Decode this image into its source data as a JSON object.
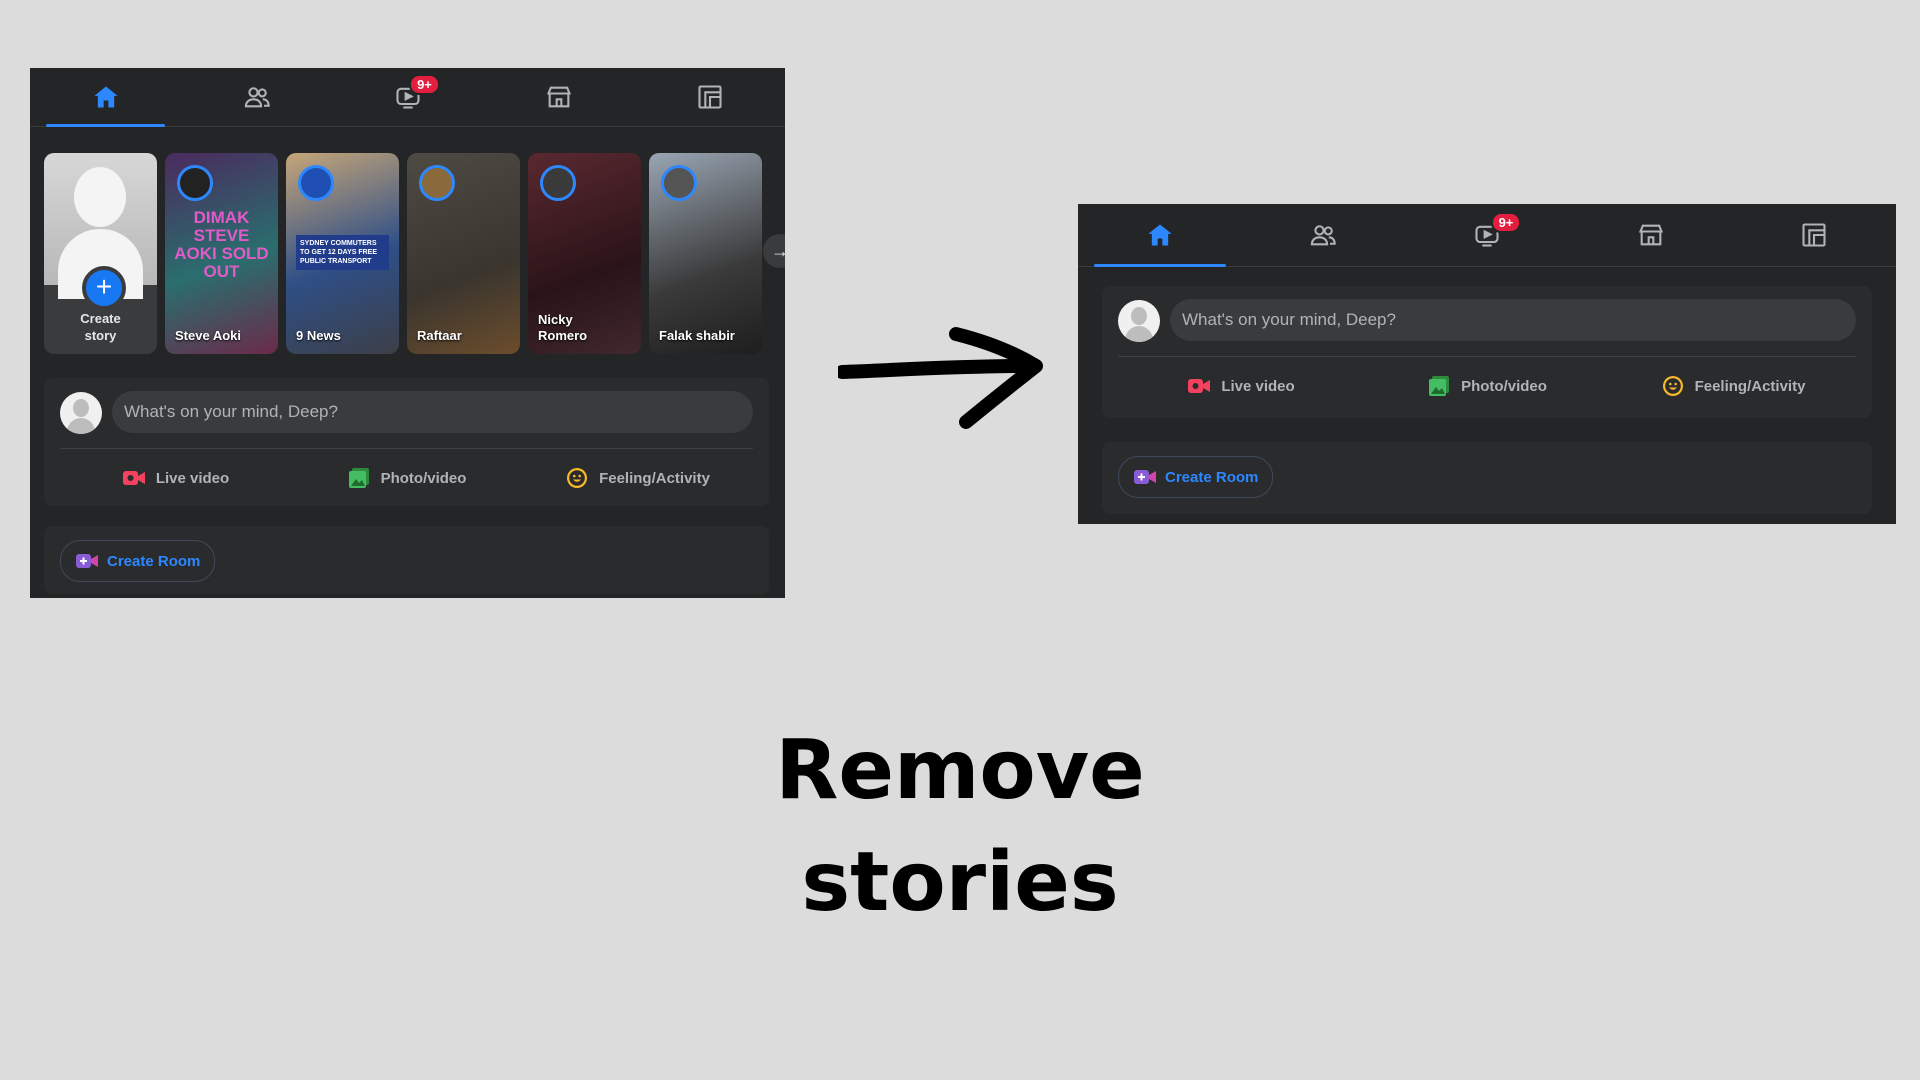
{
  "nav": {
    "tabs": [
      {
        "icon": "home-icon",
        "active": true
      },
      {
        "icon": "friends-icon",
        "active": false
      },
      {
        "icon": "watch-icon",
        "active": false,
        "badge": "9+"
      },
      {
        "icon": "marketplace-icon",
        "active": false
      },
      {
        "icon": "gaming-icon",
        "active": false
      }
    ],
    "accent": "#2d88ff",
    "badge_color": "#e41e3f"
  },
  "stories": {
    "create_label": "Create\nstory",
    "items": [
      {
        "name": "Steve Aoki",
        "art": "DIMAK STEVE AOKI SOLD OUT"
      },
      {
        "name": "9 News",
        "art": "SYDNEY COMMUTERS TO GET 12 DAYS FREE PUBLIC TRANSPORT"
      },
      {
        "name": "Raftaar"
      },
      {
        "name": "Nicky\nRomero"
      },
      {
        "name": "Falak shabir"
      }
    ]
  },
  "composer": {
    "placeholder": "What's on your mind, Deep?",
    "live_video": "Live video",
    "photo_video": "Photo/video",
    "feeling": "Feeling/Activity"
  },
  "room": {
    "create_room": "Create Room"
  },
  "caption": {
    "line1": "Remove",
    "line2": "stories"
  }
}
